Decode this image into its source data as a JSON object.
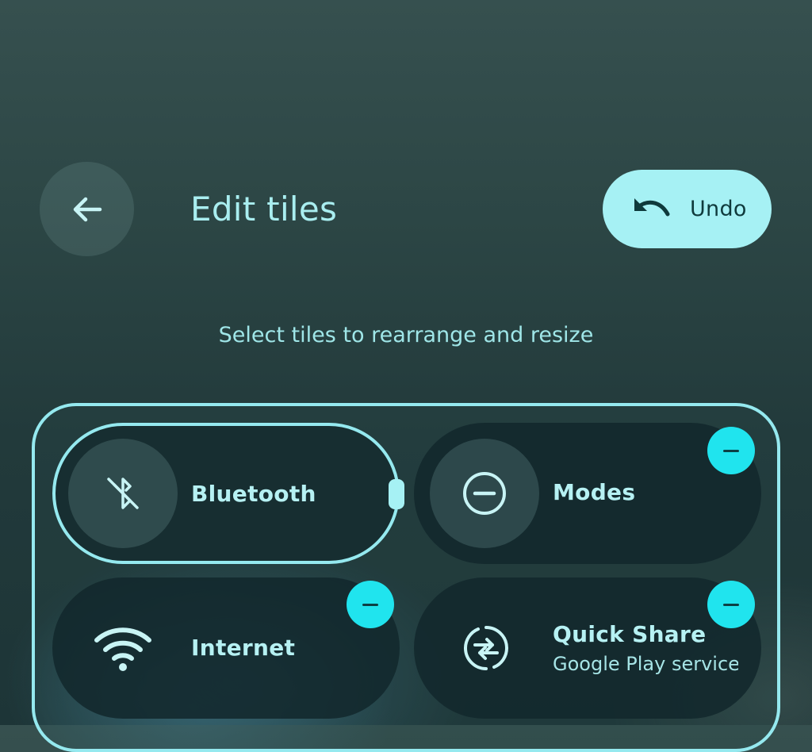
{
  "header": {
    "title": "Edit tiles",
    "undo_label": "Undo",
    "back_icon": "arrow-left-icon",
    "undo_icon": "undo-icon"
  },
  "subtitle": "Select tiles to rearrange and resize",
  "tiles": [
    {
      "label": "Bluetooth",
      "icon": "bluetooth-off-icon",
      "selected": true,
      "removable": false
    },
    {
      "label": "Modes",
      "icon": "do-not-disturb-icon",
      "selected": false,
      "removable": true
    },
    {
      "label": "Internet",
      "icon": "wifi-icon",
      "selected": false,
      "removable": true
    },
    {
      "label": "Quick Share",
      "secondary": "Google Play services",
      "icon": "quick-share-icon",
      "selected": false,
      "removable": true
    }
  ],
  "colors": {
    "accent": "#a6f1f4",
    "badge": "#20e4ee",
    "text": "#b6f1f3"
  }
}
